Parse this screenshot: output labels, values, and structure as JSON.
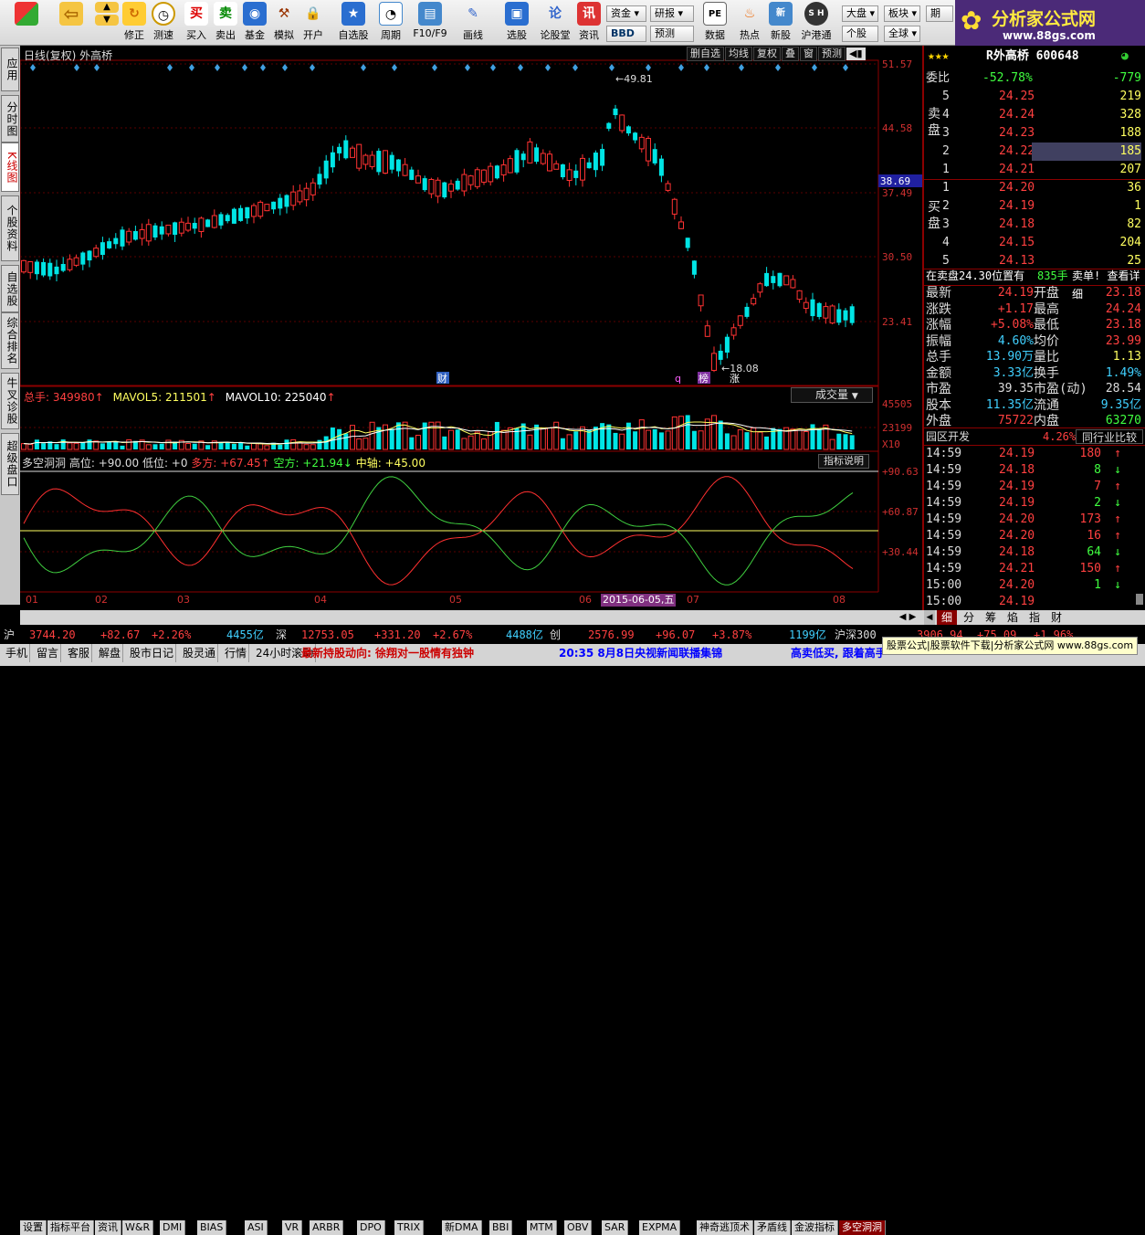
{
  "toolbar": {
    "buttons": [
      "修正",
      "测速",
      "买入",
      "卖出",
      "基金",
      "模拟",
      "开户",
      "自选股",
      "周期",
      "F10/F9",
      "画线",
      "选股",
      "论股堂",
      "资讯",
      "数据",
      "热点",
      "新股",
      "沪港通"
    ],
    "small": [
      "资金",
      "研报",
      "BBD",
      "预测",
      "大盘",
      "板块",
      "期",
      "个股",
      "全球"
    ]
  },
  "logo": {
    "title": "分析家公式网",
    "url": "www.88gs.com"
  },
  "left_tabs": [
    "应用",
    "分时图",
    "K线图",
    "个股资料",
    "自选股",
    "综合排名",
    "牛叉诊股",
    "超级盘口"
  ],
  "kchart": {
    "header": "日线(复权)  外高桥",
    "menu": [
      "删自选",
      "均线",
      "复权",
      "叠",
      "窗",
      "预测"
    ],
    "y_ticks": [
      "51.57",
      "44.58",
      "37.49",
      "30.50",
      "23.41"
    ],
    "current_price": "38.69",
    "high_label": "49.81",
    "low_label": "18.08",
    "markers": [
      "财",
      "q",
      "榜",
      "涨"
    ]
  },
  "volume": {
    "total": "总手: 349980",
    "mavol5": "MAVOL5: 211501",
    "mavol10": "MAVOL10: 225040",
    "dropdown": "成交量",
    "y_ticks": [
      "45505",
      "23199",
      "X10"
    ]
  },
  "indicator": {
    "label": "多空洞洞",
    "high": "高位: +90.00",
    "low": "低位: +0",
    "bull": "多方: +67.45",
    "bear": "空方: +21.94",
    "mid": "中轴: +45.00",
    "explain": "指标说明",
    "y_ticks": [
      "+90.63",
      "+60.87",
      "+30.44"
    ]
  },
  "x_axis": [
    "01",
    "02",
    "03",
    "04",
    "05",
    "06",
    "07",
    "08"
  ],
  "date_highlight": "2015-06-05,五",
  "bottom_tabs": [
    "设置",
    "指标平台",
    "资讯",
    "W&R",
    "DMI",
    "BIAS",
    "ASI",
    "VR",
    "ARBR",
    "DPO",
    "TRIX",
    "新DMA",
    "BBI",
    "MTM",
    "OBV",
    "SAR",
    "EXPMA",
    "神奇逃顶术",
    "矛盾线",
    "金波指标",
    "多空洞洞"
  ],
  "stock": {
    "name": "R外高桥 600648",
    "weibi": "委比",
    "weibi_pct": "-52.78%",
    "weibi_diff": "-779",
    "sell": [
      [
        "5",
        "24.25",
        "219"
      ],
      [
        "4",
        "24.24",
        "328"
      ],
      [
        "3",
        "24.23",
        "188"
      ],
      [
        "2",
        "24.22",
        "185"
      ],
      [
        "1",
        "24.21",
        "207"
      ]
    ],
    "buy": [
      [
        "1",
        "24.20",
        "36"
      ],
      [
        "2",
        "24.19",
        "1"
      ],
      [
        "3",
        "24.18",
        "82"
      ],
      [
        "4",
        "24.15",
        "204"
      ],
      [
        "5",
        "24.13",
        "25"
      ]
    ],
    "sell_label": "卖盘",
    "buy_label": "买盘",
    "notice": "在卖盘24.30位置有",
    "notice_num": "835手",
    "notice_tail": "卖单! 查看详细",
    "stats": [
      [
        "最新",
        "24.19",
        "开盘",
        "23.18"
      ],
      [
        "涨跌",
        "+1.17",
        "最高",
        "24.24"
      ],
      [
        "涨幅",
        "+5.08%",
        "最低",
        "23.18"
      ],
      [
        "振幅",
        "4.60%",
        "均价",
        "23.99"
      ],
      [
        "总手",
        "13.90万",
        "量比",
        "1.13"
      ],
      [
        "金额",
        "3.33亿",
        "换手",
        "1.49%"
      ],
      [
        "市盈",
        "39.35",
        "市盈(动)",
        "28.54"
      ],
      [
        "股本",
        "11.35亿",
        "流通",
        "9.35亿"
      ],
      [
        "外盘",
        "75722",
        "内盘",
        "63270"
      ]
    ],
    "sector": "园区开发",
    "sector_pct": "4.26%",
    "sector_link": "同行业比较",
    "ticks": [
      [
        "14:59",
        "24.19",
        "180",
        "up"
      ],
      [
        "14:59",
        "24.18",
        "8",
        "down"
      ],
      [
        "14:59",
        "24.19",
        "7",
        "up"
      ],
      [
        "14:59",
        "24.19",
        "2",
        "down"
      ],
      [
        "14:59",
        "24.20",
        "173",
        "up"
      ],
      [
        "14:59",
        "24.20",
        "16",
        "up"
      ],
      [
        "14:59",
        "24.18",
        "64",
        "down"
      ],
      [
        "14:59",
        "24.21",
        "150",
        "up"
      ],
      [
        "15:00",
        "24.20",
        "1",
        "down"
      ],
      [
        "15:00",
        "24.19",
        "",
        ""
      ]
    ],
    "right_tabs": [
      "细",
      "分",
      "筹",
      "焰",
      "指",
      "财"
    ]
  },
  "index_bar": {
    "sh": [
      "沪",
      "3744.20",
      "+82.67",
      "+2.26%",
      "4455亿"
    ],
    "sz": [
      "深",
      "12753.05",
      "+331.20",
      "+2.67%",
      "4488亿"
    ],
    "cy": [
      "创",
      "2576.99",
      "+96.07",
      "+3.87%",
      "1199亿"
    ],
    "hs300": [
      "沪深300",
      "3906.94",
      "+75.09",
      "+1.96%"
    ]
  },
  "status_bar": {
    "items": [
      "手机",
      "留言",
      "客服",
      "解盘",
      "股市日记",
      "股灵通",
      "行情",
      "24小时滚动"
    ],
    "news1": "最新持股动向: 徐翔对一股情有独钟",
    "news2": "20:35 8月8日央视新闻联播集锦",
    "news3": "高卖低买, 跟着高手",
    "ad": "股票公式|股票软件下载|分析家公式网 www.88gs.com"
  },
  "colors": {
    "up": "#ff3232",
    "down": "#00e5e5",
    "bg": "#000000",
    "grid": "#8b0000"
  }
}
